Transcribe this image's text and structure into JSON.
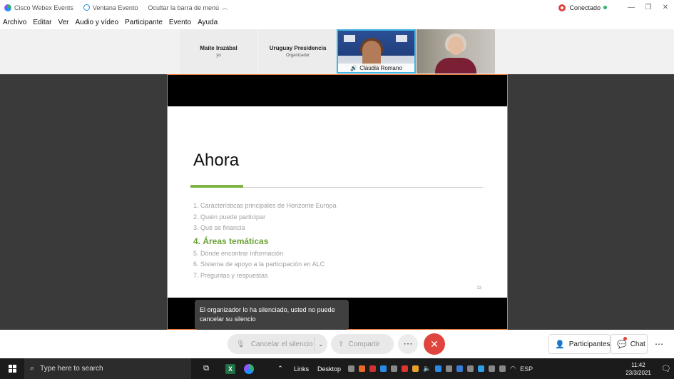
{
  "titlebar": {
    "app_name": "Cisco Webex Events",
    "event_window": "Ventana Evento",
    "hide_menu": "Ocultar la barra de menú",
    "status": "Conectado"
  },
  "menu": [
    "Archivo",
    "Editar",
    "Ver",
    "Audio y vídeo",
    "Participante",
    "Evento",
    "Ayuda"
  ],
  "participants": {
    "p1": {
      "name": "Maite Irazábal",
      "role": "yo"
    },
    "p2": {
      "name": "Uruguay Presidencia",
      "role": "Organizador"
    },
    "p3": {
      "name": "Claudia Romano"
    }
  },
  "slide": {
    "title": "Ahora",
    "items": [
      "1. Características principales de Horizonte Europa",
      "2. Quién puede participar",
      "3. Qué se financia",
      "4. Áreas temáticas",
      "5. Dónde encontrar información",
      "6. Sistema de apoyo a la participación en ALC",
      "7. Preguntas y respuestas"
    ],
    "active_index": 3,
    "page_number": "13",
    "accent": "#7cb342"
  },
  "toast": "El organizador lo ha silenciado, usted no puede cancelar su silencio",
  "controls": {
    "unmute": "Cancelar el silencio",
    "share": "Compartir",
    "participants": "Participantes",
    "chat": "Chat",
    "end_color": "#e0443e"
  },
  "taskbar": {
    "search_placeholder": "Type here to search",
    "links": "Links",
    "desktop": "Desktop",
    "lang": "ESP",
    "time": "11:42",
    "date": "23/3/2021"
  },
  "colors": {
    "share_border": "#e8702a",
    "video_highlight": "#3fb4e6"
  }
}
